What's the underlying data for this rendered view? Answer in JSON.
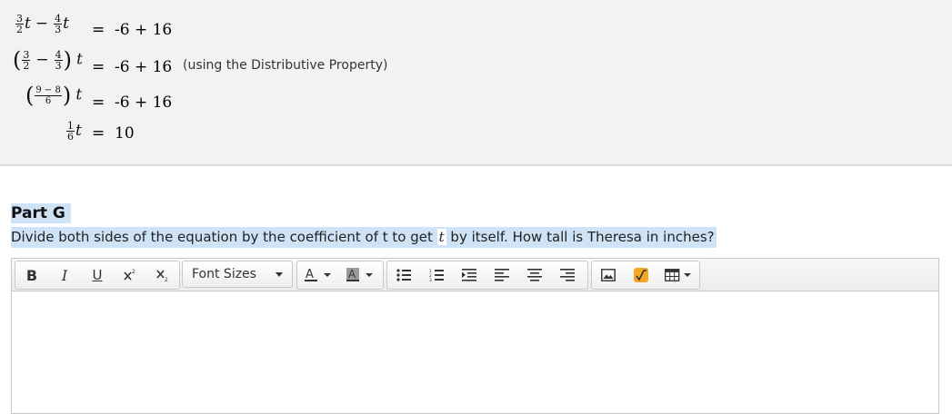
{
  "work": {
    "line1": {
      "lhs_a_num": "3",
      "lhs_a_den": "2",
      "lhs_var": "t",
      "lhs_op": "−",
      "lhs_b_num": "4",
      "lhs_b_den": "3",
      "eq": "=",
      "rhs": "-6 + 16"
    },
    "line2": {
      "a_num": "3",
      "a_den": "2",
      "op": "−",
      "b_num": "4",
      "b_den": "3",
      "var": "t",
      "eq": "=",
      "rhs": "-6 + 16",
      "note": "(using the Distributive Property)"
    },
    "line3": {
      "num": "9 − 8",
      "den": "6",
      "var": "t",
      "eq": "=",
      "rhs": "-6 + 16"
    },
    "line4": {
      "num": "1",
      "den": "6",
      "var": "t",
      "eq": "=",
      "rhs": "10"
    }
  },
  "part": {
    "title": "Part G",
    "question_before": "Divide both sides of the equation by the coefficient of t to get ",
    "question_var": "t",
    "question_after": " by itself. How tall is Theresa in inches?"
  },
  "toolbar": {
    "bold": "B",
    "italic": "I",
    "underline": "U",
    "font_sizes": "Font Sizes"
  },
  "colors": {
    "highlight": "#cfe3f7",
    "equation_icon": "#f5a623"
  }
}
